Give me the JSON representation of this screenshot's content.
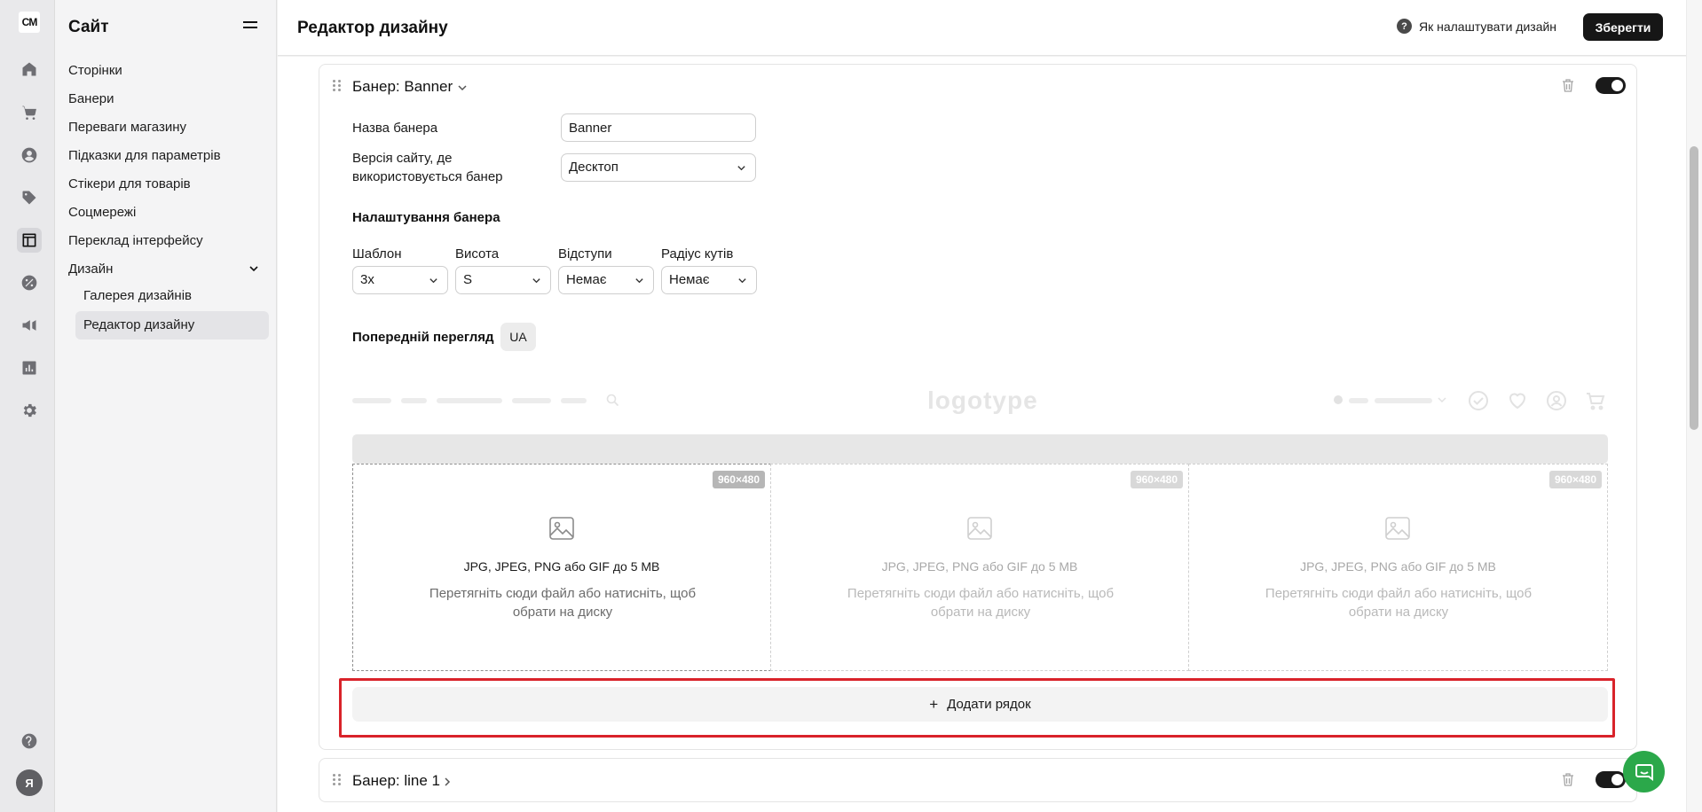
{
  "rail": {
    "logo_text": "CM",
    "icons": [
      "home-icon",
      "cart-icon",
      "user-icon",
      "tag-icon",
      "layout-icon",
      "discount-icon",
      "megaphone-icon",
      "analytics-icon",
      "settings-icon",
      "help-icon"
    ],
    "avatar_letter": "Я"
  },
  "sidebar": {
    "title": "Сайт",
    "items": [
      {
        "label": "Сторінки"
      },
      {
        "label": "Банери"
      },
      {
        "label": "Переваги магазину"
      },
      {
        "label": "Підказки для параметрів"
      },
      {
        "label": "Стікери для товарів"
      },
      {
        "label": "Соцмережі"
      },
      {
        "label": "Переклад інтерфейсу"
      },
      {
        "label": "Дизайн"
      }
    ],
    "sub_items": [
      {
        "label": "Галерея дизайнів"
      },
      {
        "label": "Редактор дизайну"
      }
    ]
  },
  "header": {
    "title": "Редактор дизайну",
    "help_label": "Як налаштувати дизайн",
    "help_icon_glyph": "?",
    "save_label": "Зберегти"
  },
  "banner_card": {
    "title": "Банер: Banner",
    "enabled": true,
    "name_label": "Назва банера",
    "name_value": "Banner",
    "version_label": "Версія сайту, де використовується банер",
    "version_value": "Десктоп",
    "settings_title": "Налаштування банера",
    "settings": [
      {
        "label": "Шаблон",
        "value": "3х"
      },
      {
        "label": "Висота",
        "value": "S"
      },
      {
        "label": "Відступи",
        "value": "Немає"
      },
      {
        "label": "Радіус кутів",
        "value": "Немає"
      }
    ],
    "preview_title": "Попередній перегляд",
    "preview_lang": "UA",
    "preview_logo": "logotype",
    "cells": [
      {
        "size": "960×480",
        "formats": "JPG, JPEG, PNG або GIF до 5 MB",
        "hint": "Перетягніть сюди файл або натисніть, щоб обрати на диску"
      },
      {
        "size": "960×480",
        "formats": "JPG, JPEG, PNG або GIF до 5 MB",
        "hint": "Перетягніть сюди файл або натисніть, щоб обрати на диску"
      },
      {
        "size": "960×480",
        "formats": "JPG, JPEG, PNG або GIF до 5 MB",
        "hint": "Перетягніть сюди файл або натисніть, щоб обрати на диску"
      }
    ],
    "add_row_label": "Додати рядок",
    "add_row_glyph": "+"
  },
  "second_card": {
    "title": "Банер: line 1",
    "enabled": true
  },
  "colors": {
    "accent": "#161616",
    "highlight": "#d9232a",
    "chat": "#2ba84a"
  }
}
